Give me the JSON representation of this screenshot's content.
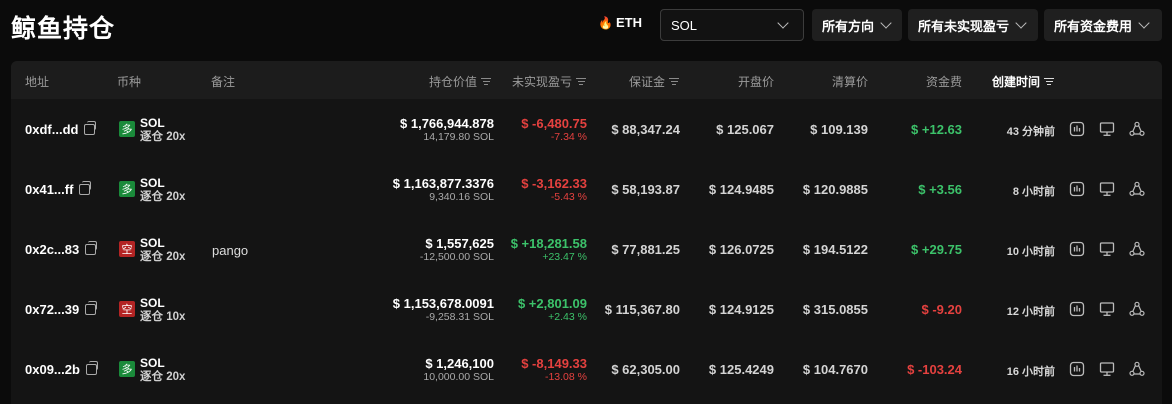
{
  "page": {
    "title": "鲸鱼持仓"
  },
  "toolbar": {
    "hot_coin": "ETH",
    "coin_select": "SOL",
    "direction_select": "所有方向",
    "pnl_select": "所有未实现盈亏",
    "funding_select": "所有资金费用"
  },
  "table": {
    "headers": {
      "address": "地址",
      "coin": "币种",
      "note": "备注",
      "value": "持仓价值",
      "upnl": "未实现盈亏",
      "margin": "保证金",
      "entry": "开盘价",
      "liq": "清算价",
      "funding": "资金费",
      "created": "创建时间"
    },
    "rows": [
      {
        "address": "0xdf...dd",
        "side": "多",
        "side_type": "long",
        "coin": "SOL",
        "leverage": "逐仓 20x",
        "note": "",
        "value": "$ 1,766,944.878",
        "size": "14,179.80 SOL",
        "upnl": "$ -6,480.75",
        "upnl_pct": "-7.34 %",
        "upnl_type": "neg",
        "margin": "$ 88,347.24",
        "entry": "$ 125.067",
        "liq": "$ 109.139",
        "funding": "$ +12.63",
        "funding_type": "pos",
        "created": "43 分钟前"
      },
      {
        "address": "0x41...ff",
        "side": "多",
        "side_type": "long",
        "coin": "SOL",
        "leverage": "逐仓 20x",
        "note": "",
        "value": "$ 1,163,877.3376",
        "size": "9,340.16 SOL",
        "upnl": "$ -3,162.33",
        "upnl_pct": "-5.43 %",
        "upnl_type": "neg",
        "margin": "$ 58,193.87",
        "entry": "$ 124.9485",
        "liq": "$ 120.9885",
        "funding": "$ +3.56",
        "funding_type": "pos",
        "created": "8 小时前"
      },
      {
        "address": "0x2c...83",
        "side": "空",
        "side_type": "short",
        "coin": "SOL",
        "leverage": "逐仓 20x",
        "note": "pango",
        "value": "$ 1,557,625",
        "size": "-12,500.00 SOL",
        "upnl": "$ +18,281.58",
        "upnl_pct": "+23.47 %",
        "upnl_type": "pos",
        "margin": "$ 77,881.25",
        "entry": "$ 126.0725",
        "liq": "$ 194.5122",
        "funding": "$ +29.75",
        "funding_type": "pos",
        "created": "10 小时前"
      },
      {
        "address": "0x72...39",
        "side": "空",
        "side_type": "short",
        "coin": "SOL",
        "leverage": "逐仓 10x",
        "note": "",
        "value": "$ 1,153,678.0091",
        "size": "-9,258.31 SOL",
        "upnl": "$ +2,801.09",
        "upnl_pct": "+2.43 %",
        "upnl_type": "pos",
        "margin": "$ 115,367.80",
        "entry": "$ 124.9125",
        "liq": "$ 315.0855",
        "funding": "$ -9.20",
        "funding_type": "neg",
        "created": "12 小时前"
      },
      {
        "address": "0x09...2b",
        "side": "多",
        "side_type": "long",
        "coin": "SOL",
        "leverage": "逐仓 20x",
        "note": "",
        "value": "$ 1,246,100",
        "size": "10,000.00 SOL",
        "upnl": "$ -8,149.33",
        "upnl_pct": "-13.08 %",
        "upnl_type": "neg",
        "margin": "$ 62,305.00",
        "entry": "$ 125.4249",
        "liq": "$ 104.7670",
        "funding": "$ -103.24",
        "funding_type": "neg",
        "created": "16 小时前"
      }
    ]
  },
  "colors": {
    "positive": "#3cc26a",
    "negative": "#e5413f",
    "long_badge": "#1a8a3a",
    "short_badge": "#b32424",
    "background": "#0b0b0b"
  },
  "icons": {
    "copy": "copy-icon",
    "chart": "chart-icon",
    "monitor": "monitor-icon",
    "share": "share-icon",
    "flame": "flame-icon"
  }
}
